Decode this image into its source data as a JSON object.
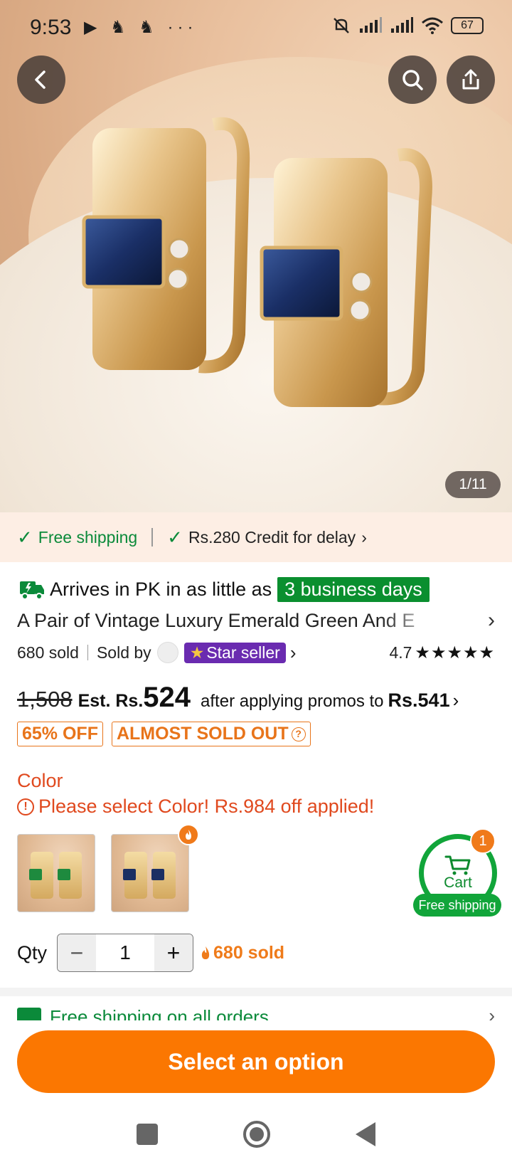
{
  "status": {
    "time": "9:53",
    "left_icons": "▶ ♞ ♞ ···",
    "battery": "67"
  },
  "hero": {
    "page_indicator": "1/11"
  },
  "shipping_strip": {
    "free_shipping": "Free shipping",
    "credit": "Rs.280 Credit for delay",
    "credit_chevron": "›"
  },
  "delivery": {
    "text": "Arrives in PK in as little as",
    "badge": "3 business days"
  },
  "product": {
    "title": "A Pair of Vintage Luxury Emerald Green And E",
    "chevron": "›",
    "sold": "680 sold",
    "sold_by": "Sold by",
    "star_seller": "Star seller",
    "seller_chevron": "›",
    "rating": "4.7",
    "stars": "★★★★★"
  },
  "price": {
    "old": "1,508",
    "est_label": "Est. Rs.",
    "est_value": "524",
    "promo_text": "after applying promos to",
    "promo_price": "Rs.541",
    "promo_chevron": "›"
  },
  "tags": {
    "discount": "65% OFF",
    "stock": "ALMOST SOLD OUT",
    "help": "?"
  },
  "color": {
    "label": "Color",
    "warning": "Please select Color! Rs.984 off applied!",
    "warning_icon": "!",
    "options": [
      "green",
      "blue"
    ]
  },
  "cart": {
    "label": "Cart",
    "count": "1",
    "free_shipping": "Free shipping"
  },
  "quantity": {
    "label": "Qty",
    "minus": "−",
    "value": "1",
    "plus": "+",
    "sold": "680 sold"
  },
  "peek": {
    "text": "Free shipping on all orders",
    "chevron": "›"
  },
  "cta": {
    "label": "Select an option"
  },
  "colors": {
    "accent_orange": "#fb7701",
    "green": "#0b8a3a",
    "star_seller_purple": "#6a2bb0",
    "warning_red": "#e0491e"
  }
}
